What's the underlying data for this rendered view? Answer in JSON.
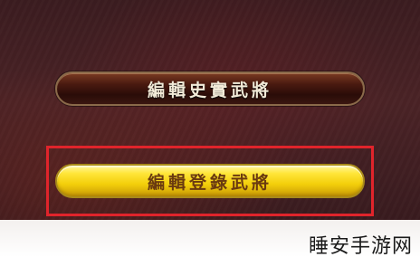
{
  "menu": {
    "items": [
      {
        "label": "編輯史實武將"
      },
      {
        "label": "編輯登錄武將",
        "highlighted": true
      }
    ]
  },
  "watermark": {
    "text": "睡安手游网"
  },
  "colors": {
    "highlight_frame": "#e0242b",
    "selected_button": "#f3cf0b",
    "default_button": "#4a1a10"
  }
}
